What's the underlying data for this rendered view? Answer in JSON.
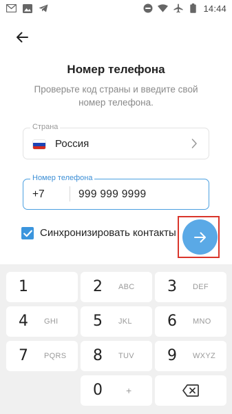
{
  "status_bar": {
    "time": "14:44",
    "left_icons": [
      "gmail-icon",
      "image-icon",
      "telegram-icon"
    ],
    "right_icons": [
      "dnd-icon",
      "wifi-icon",
      "airplane-icon",
      "battery-icon"
    ]
  },
  "header": {
    "title": "Номер телефона",
    "subtitle": "Проверьте код страны и введите свой номер телефона."
  },
  "country": {
    "label": "Страна",
    "value": "Россия",
    "flag_colors": [
      "#ffffff",
      "#1c44b5",
      "#d52b1e"
    ]
  },
  "phone": {
    "label": "Номер телефона",
    "code": "+7",
    "number": "999 999 9999"
  },
  "sync": {
    "label": "Синхронизировать контакты",
    "checked": true
  },
  "colors": {
    "accent": "#3b95dd",
    "next_button": "#5aa9e6",
    "highlight": "#d9352b"
  },
  "keypad": {
    "keys": [
      {
        "digit": "1",
        "letters": ""
      },
      {
        "digit": "2",
        "letters": "ABC"
      },
      {
        "digit": "3",
        "letters": "DEF"
      },
      {
        "digit": "4",
        "letters": "GHI"
      },
      {
        "digit": "5",
        "letters": "JKL"
      },
      {
        "digit": "6",
        "letters": "MNO"
      },
      {
        "digit": "7",
        "letters": "PQRS"
      },
      {
        "digit": "8",
        "letters": "TUV"
      },
      {
        "digit": "9",
        "letters": "WXYZ"
      },
      {
        "digit": "0",
        "letters": "+"
      }
    ]
  }
}
